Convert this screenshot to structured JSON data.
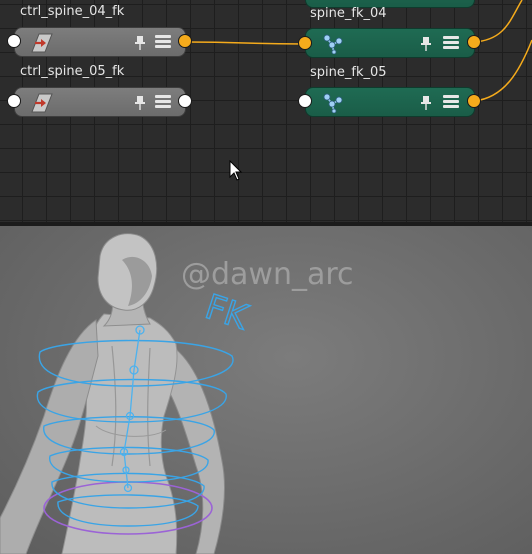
{
  "node_editor": {
    "nodes": [
      {
        "label": "ctrl_spine_04_fk",
        "style": "gray",
        "icon": "control-icon"
      },
      {
        "label": "ctrl_spine_05_fk",
        "style": "gray",
        "icon": "control-icon"
      },
      {
        "label": "spine_fk_04",
        "style": "green",
        "icon": "joint-icon"
      },
      {
        "label": "spine_fk_05",
        "style": "green",
        "icon": "joint-icon"
      }
    ],
    "colors": {
      "wire": "#f5ab1c",
      "gray_node": "#737373",
      "green_node": "#1d6450",
      "grid": "#2c2c2c"
    }
  },
  "viewport": {
    "watermark": "@dawn_arc",
    "annotation": "FK",
    "colors": {
      "control_curve": "#3aa4e6",
      "selected_curve": "#9b63d6",
      "mesh": "#bdbdbd"
    }
  }
}
